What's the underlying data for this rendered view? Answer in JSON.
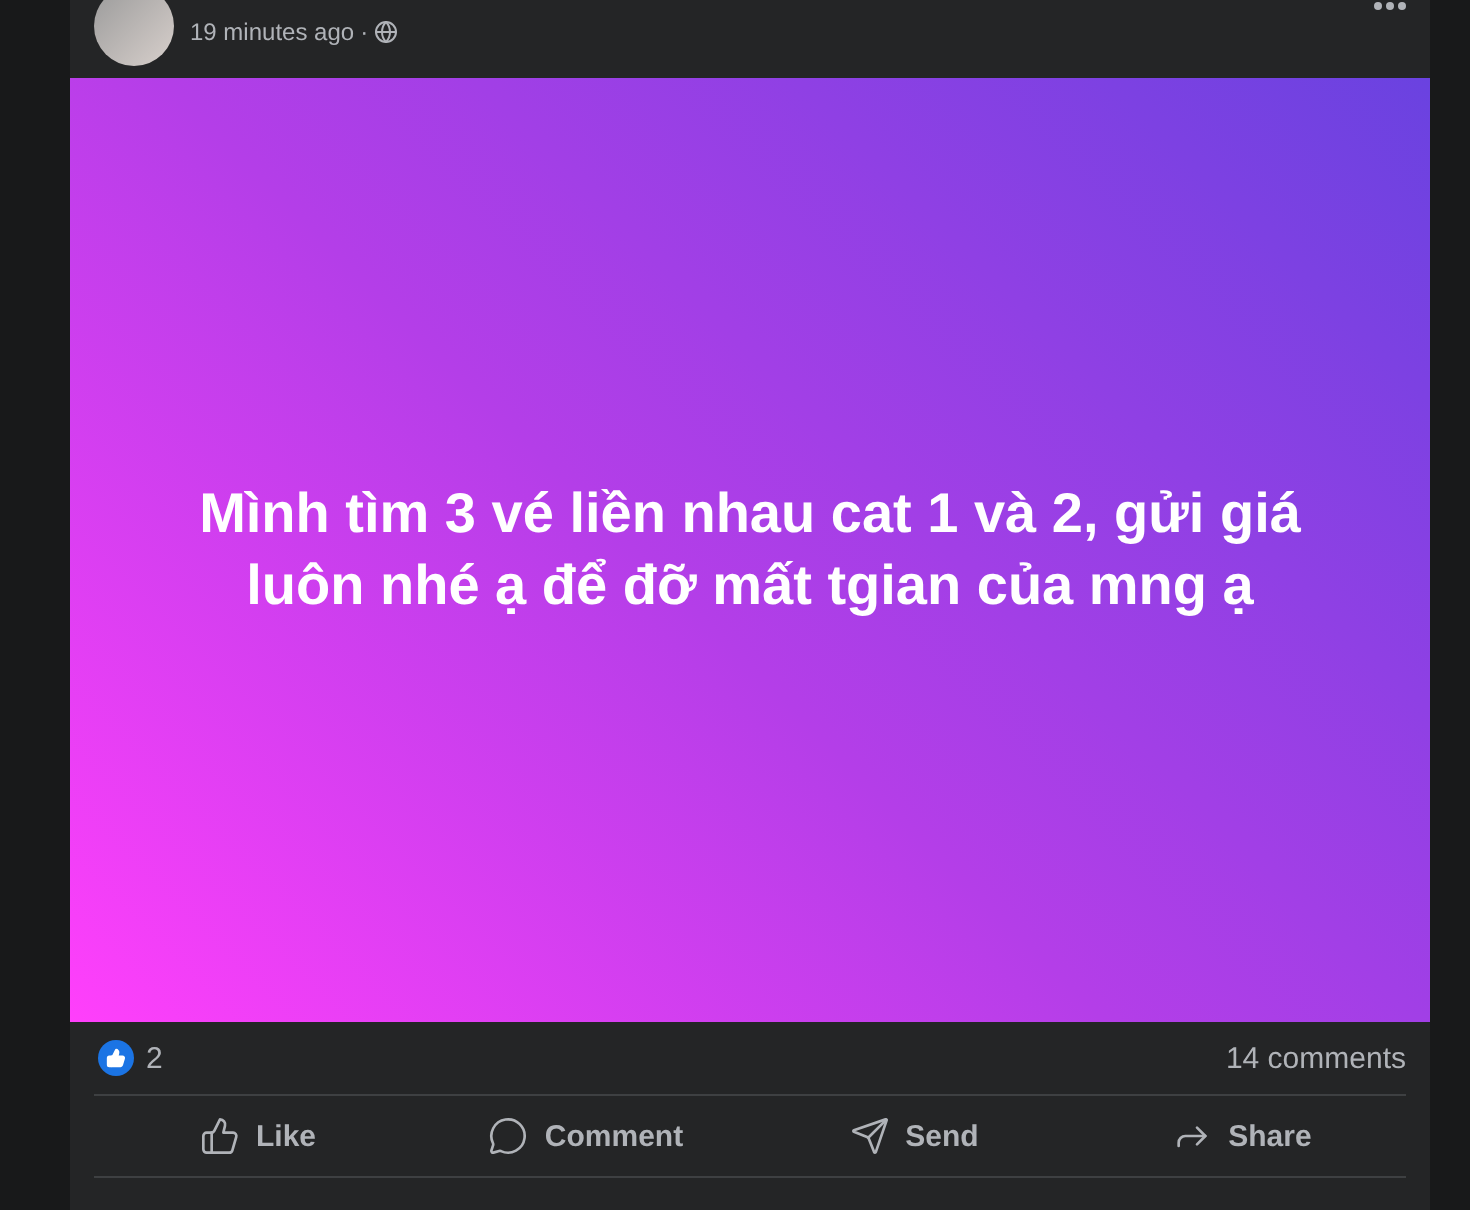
{
  "post": {
    "time": "19 minutes ago",
    "separator": "·",
    "text": "Mình tìm 3 vé liền nhau cat 1 và 2, gửi giá luôn nhé ạ để đỡ mất tgian của mng ạ",
    "reaction_count": "2",
    "comment_count": "14 comments"
  },
  "actions": [
    {
      "kind": "like",
      "label": "Like"
    },
    {
      "kind": "comment",
      "label": "Comment"
    },
    {
      "kind": "send",
      "label": "Send"
    },
    {
      "kind": "share",
      "label": "Share"
    }
  ]
}
